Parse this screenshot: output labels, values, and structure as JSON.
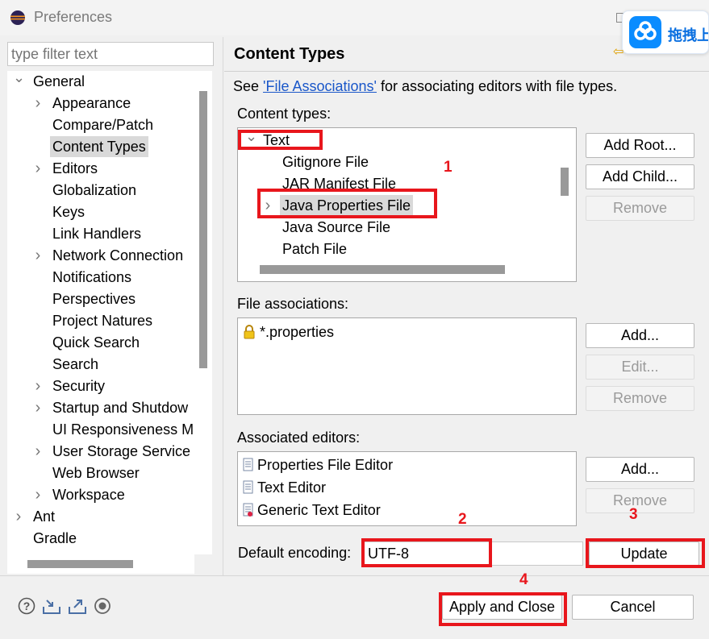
{
  "window": {
    "title": "Preferences"
  },
  "overlay_badge": {
    "label": "拖拽上"
  },
  "sidebar": {
    "filter_placeholder": "type filter text",
    "items": [
      {
        "label": "General",
        "expander": "expanded"
      },
      {
        "label": "Appearance",
        "expander": "collapsed"
      },
      {
        "label": "Compare/Patch",
        "expander": "none"
      },
      {
        "label": "Content Types",
        "expander": "none",
        "selected": true
      },
      {
        "label": "Editors",
        "expander": "collapsed"
      },
      {
        "label": "Globalization",
        "expander": "none"
      },
      {
        "label": "Keys",
        "expander": "none"
      },
      {
        "label": "Link Handlers",
        "expander": "none"
      },
      {
        "label": "Network Connection",
        "expander": "collapsed"
      },
      {
        "label": "Notifications",
        "expander": "none"
      },
      {
        "label": "Perspectives",
        "expander": "none"
      },
      {
        "label": "Project Natures",
        "expander": "none"
      },
      {
        "label": "Quick Search",
        "expander": "none"
      },
      {
        "label": "Search",
        "expander": "none"
      },
      {
        "label": "Security",
        "expander": "collapsed"
      },
      {
        "label": "Startup and Shutdow",
        "expander": "collapsed"
      },
      {
        "label": "UI Responsiveness M",
        "expander": "none"
      },
      {
        "label": "User Storage Service",
        "expander": "collapsed"
      },
      {
        "label": "Web Browser",
        "expander": "none"
      },
      {
        "label": "Workspace",
        "expander": "collapsed"
      },
      {
        "label": "Ant",
        "expander": "collapsed"
      },
      {
        "label": "Gradle",
        "expander": "none"
      }
    ]
  },
  "main": {
    "title": "Content Types",
    "see_prefix": "See ",
    "see_link": "'File Associations'",
    "see_suffix": " for associating editors with file types.",
    "content_types_label": "Content types:",
    "content_types": [
      {
        "label": "Text",
        "expander": "expanded"
      },
      {
        "label": "Gitignore File",
        "expander": "none"
      },
      {
        "label": "JAR Manifest File",
        "expander": "none"
      },
      {
        "label": "Java Properties File",
        "expander": "collapsed",
        "selected": true
      },
      {
        "label": "Java Source File",
        "expander": "none"
      },
      {
        "label": "Patch File",
        "expander": "none"
      }
    ],
    "content_buttons": {
      "add_root": "Add Root...",
      "add_child": "Add Child...",
      "remove": "Remove"
    },
    "file_assoc_label": "File associations:",
    "file_associations": [
      {
        "label": "*.properties",
        "icon": "lock-icon"
      }
    ],
    "file_assoc_buttons": {
      "add": "Add...",
      "edit": "Edit...",
      "remove": "Remove"
    },
    "editors_label": "Associated editors:",
    "editors": [
      {
        "label": "Properties File Editor",
        "icon": "text-file-icon"
      },
      {
        "label": "Text Editor",
        "icon": "text-file-icon"
      },
      {
        "label": "Generic Text Editor",
        "icon": "generic-editor-icon"
      }
    ],
    "editor_buttons": {
      "add": "Add...",
      "remove": "Remove"
    },
    "encoding_label": "Default encoding:",
    "encoding_value": "UTF-8",
    "update_button": "Update"
  },
  "annotations": {
    "n1": "1",
    "n2": "2",
    "n3": "3",
    "n4": "4",
    "color": "#e8161c"
  },
  "footer": {
    "apply_close": "Apply and Close",
    "cancel": "Cancel"
  }
}
